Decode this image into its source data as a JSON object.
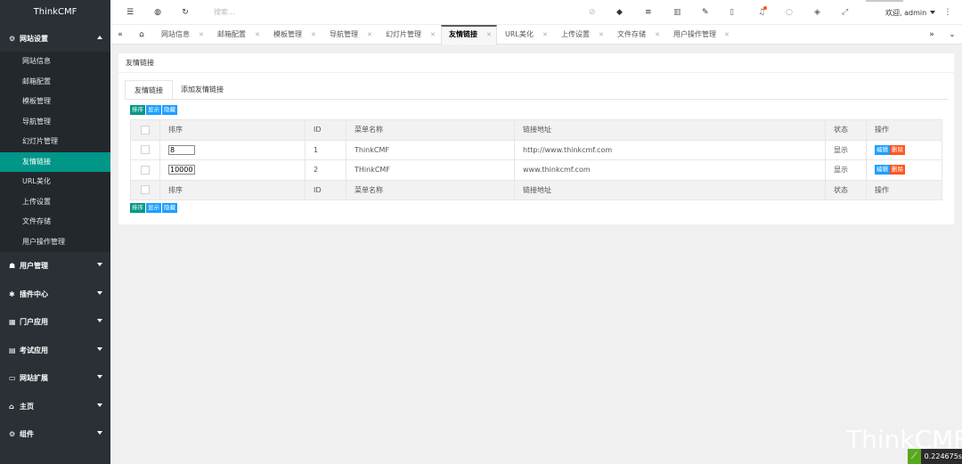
{
  "app": {
    "title": "ThinkCMF"
  },
  "sidebar": {
    "open_menu": {
      "label": "网站设置",
      "icon": "gear-icon"
    },
    "sub_items": [
      {
        "label": "网站信息"
      },
      {
        "label": "邮箱配置"
      },
      {
        "label": "模板管理"
      },
      {
        "label": "导航管理"
      },
      {
        "label": "幻灯片管理"
      },
      {
        "label": "友情链接",
        "active": true
      },
      {
        "label": "URL美化"
      },
      {
        "label": "上传设置"
      },
      {
        "label": "文件存储"
      },
      {
        "label": "用户操作管理"
      }
    ],
    "menus": [
      {
        "label": "用户管理",
        "icon": "users-icon"
      },
      {
        "label": "插件中心",
        "icon": "plugin-icon"
      },
      {
        "label": "门户应用",
        "icon": "grid-icon"
      },
      {
        "label": "考试应用",
        "icon": "document-icon"
      },
      {
        "label": "网站扩展",
        "icon": "monitor-icon"
      },
      {
        "label": "主页",
        "icon": "home-icon"
      },
      {
        "label": "组件",
        "icon": "settings-icon"
      }
    ]
  },
  "topbar": {
    "search_placeholder": "搜索...",
    "welcome": "欢迎, admin"
  },
  "tabs": [
    {
      "label": "网站信息"
    },
    {
      "label": "邮箱配置"
    },
    {
      "label": "模板管理"
    },
    {
      "label": "导航管理"
    },
    {
      "label": "幻灯片管理"
    },
    {
      "label": "友情链接",
      "active": true
    },
    {
      "label": "URL美化"
    },
    {
      "label": "上传设置"
    },
    {
      "label": "文件存储"
    },
    {
      "label": "用户操作管理"
    }
  ],
  "card": {
    "title": "友情链接",
    "tab_active": "友情链接",
    "tab_add": "添加友情链接",
    "buttons": {
      "sort": "排序",
      "show": "显示",
      "hide": "隐藏"
    }
  },
  "table": {
    "headers": [
      "排序",
      "ID",
      "菜单名称",
      "链接地址",
      "状态",
      "操作"
    ],
    "rows": [
      {
        "order": "8",
        "id": "1",
        "name": "ThinkCMF",
        "url": "http://www.thinkcmf.com",
        "status": "显示"
      },
      {
        "order": "10000",
        "id": "2",
        "name": "THinkCMF",
        "url": "www.thinkcmf.com",
        "status": "显示"
      }
    ],
    "actions": {
      "edit": "编辑",
      "delete": "删除"
    }
  },
  "watermark": "ThinkCMF",
  "timer": "0.224675s"
}
